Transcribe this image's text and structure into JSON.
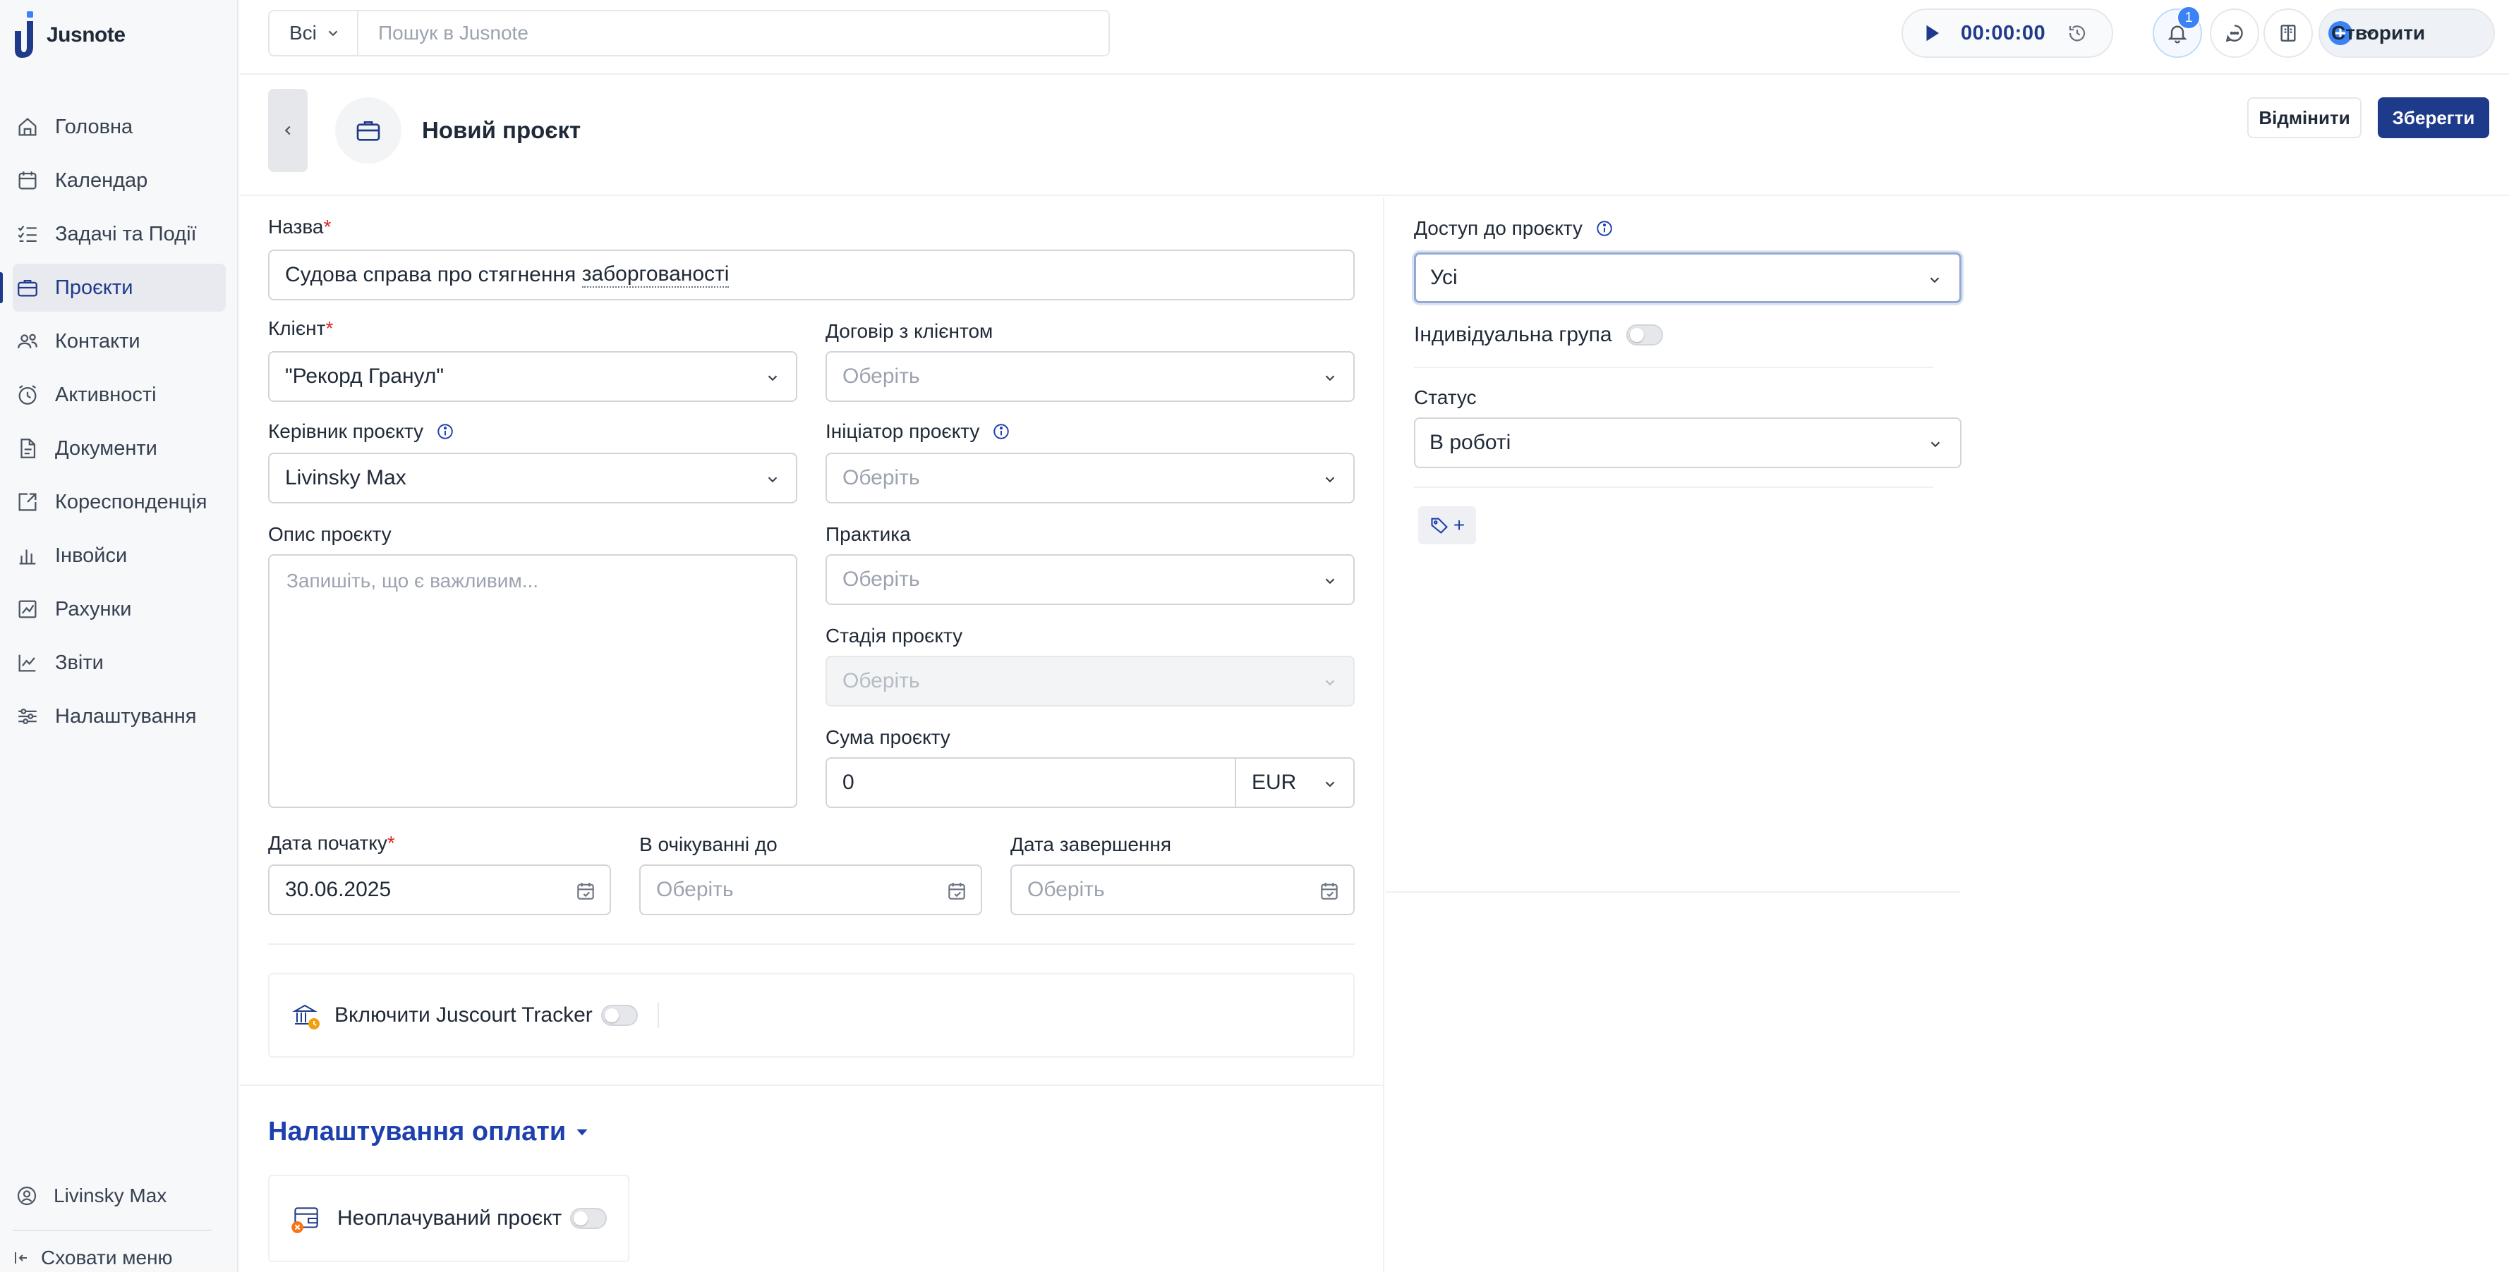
{
  "app": {
    "name": "Jusnote"
  },
  "sidebar": {
    "items": [
      {
        "label": "Головна",
        "icon": "home-icon",
        "active": false
      },
      {
        "label": "Календар",
        "icon": "calendar-icon",
        "active": false
      },
      {
        "label": "Задачі та Події",
        "icon": "tasks-icon",
        "active": false
      },
      {
        "label": "Проєкти",
        "icon": "briefcase-icon",
        "active": true
      },
      {
        "label": "Контакти",
        "icon": "contacts-icon",
        "active": false
      },
      {
        "label": "Активності",
        "icon": "clock-icon",
        "active": false
      },
      {
        "label": "Документи",
        "icon": "document-icon",
        "active": false
      },
      {
        "label": "Кореспонденція",
        "icon": "mail-icon",
        "active": false
      },
      {
        "label": "Інвойси",
        "icon": "invoice-icon",
        "active": false
      },
      {
        "label": "Рахунки",
        "icon": "bills-icon",
        "active": false
      },
      {
        "label": "Звіти",
        "icon": "chart-icon",
        "active": false
      },
      {
        "label": "Налаштування",
        "icon": "settings-icon",
        "active": false
      }
    ],
    "user": "Livinsky Max",
    "hide_menu": "Сховати меню"
  },
  "topbar": {
    "search_scope": "Всі",
    "search_placeholder": "Пошук в Jusnote",
    "timer": "00:00:00",
    "notifications_count": "1",
    "create_label": "Створити"
  },
  "header": {
    "title": "Новий проєкт",
    "cancel_label": "Відмінити",
    "save_label": "Зберегти"
  },
  "form": {
    "name": {
      "label": "Назва",
      "value_prefix": "Судова справа про стягнення ",
      "value_underlined": "заборгованості"
    },
    "client": {
      "label": "Клієнт",
      "value": "\"Рекорд Гранул\""
    },
    "contract": {
      "label": "Договір з клієнтом",
      "placeholder": "Оберіть"
    },
    "manager": {
      "label": "Керівник проєкту",
      "value": "Livinsky Max"
    },
    "initiator": {
      "label": "Ініціатор проєкту",
      "placeholder": "Оберіть"
    },
    "description": {
      "label": "Опис проєкту",
      "placeholder": "Запишіть, що є важливим..."
    },
    "practice": {
      "label": "Практика",
      "placeholder": "Оберіть"
    },
    "stage": {
      "label": "Стадія проєкту",
      "placeholder": "Оберіть"
    },
    "amount": {
      "label": "Сума проєкту",
      "value": "0",
      "currency": "EUR"
    },
    "start_date": {
      "label": "Дата початку",
      "value": "30.06.2025"
    },
    "pending_until": {
      "label": "В очікуванні до",
      "placeholder": "Оберіть"
    },
    "end_date": {
      "label": "Дата завершення",
      "placeholder": "Оберіть"
    },
    "tracker_label": "Включити Juscourt Tracker",
    "payment_title": "Налаштування оплати",
    "unpaid_label": "Неоплачуваний проєкт"
  },
  "right": {
    "access": {
      "label": "Доступ до проєкту",
      "value": "Усі"
    },
    "individual_group": "Індивідуальна група",
    "status": {
      "label": "Статус",
      "value": "В роботі"
    },
    "tag_add": "+"
  },
  "colors": {
    "brand": "#1e3a8a",
    "accent": "#3b82f6",
    "required": "#dc2626"
  }
}
